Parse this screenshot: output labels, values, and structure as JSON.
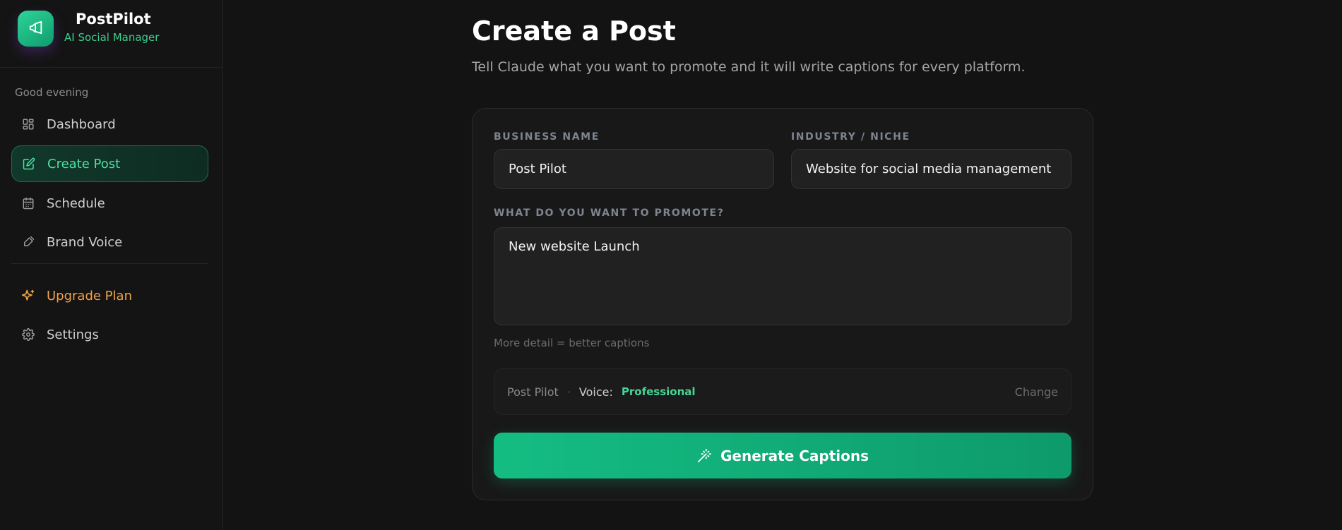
{
  "app": {
    "name": "PostPilot",
    "tagline": "AI Social Manager"
  },
  "sidebar": {
    "greeting": "Good evening",
    "items": [
      {
        "label": "Dashboard",
        "icon": "dashboard-icon"
      },
      {
        "label": "Create Post",
        "icon": "edit-icon",
        "active": true
      },
      {
        "label": "Schedule",
        "icon": "calendar-icon"
      },
      {
        "label": "Brand Voice",
        "icon": "brush-icon"
      }
    ],
    "secondary": [
      {
        "label": "Upgrade Plan",
        "icon": "sparkles-icon"
      },
      {
        "label": "Settings",
        "icon": "gear-icon"
      }
    ]
  },
  "page": {
    "title": "Create a Post",
    "subtitle": "Tell Claude what you want to promote and it will write captions for every platform."
  },
  "form": {
    "business_name": {
      "label": "BUSINESS NAME",
      "value": "Post Pilot"
    },
    "industry": {
      "label": "INDUSTRY / NICHE",
      "value": "Website for social media management"
    },
    "promote": {
      "label": "WHAT DO YOU WANT TO PROMOTE?",
      "value": "New website Launch"
    },
    "hint": "More detail = better captions",
    "voice_bar": {
      "business": "Post Pilot",
      "separator": "·",
      "voice_label": "Voice:",
      "voice_value": "Professional",
      "change_label": "Change"
    },
    "generate_label": "Generate Captions"
  },
  "colors": {
    "accent": "#14bd83",
    "upgrade": "#f0a24a",
    "background": "#131313"
  }
}
